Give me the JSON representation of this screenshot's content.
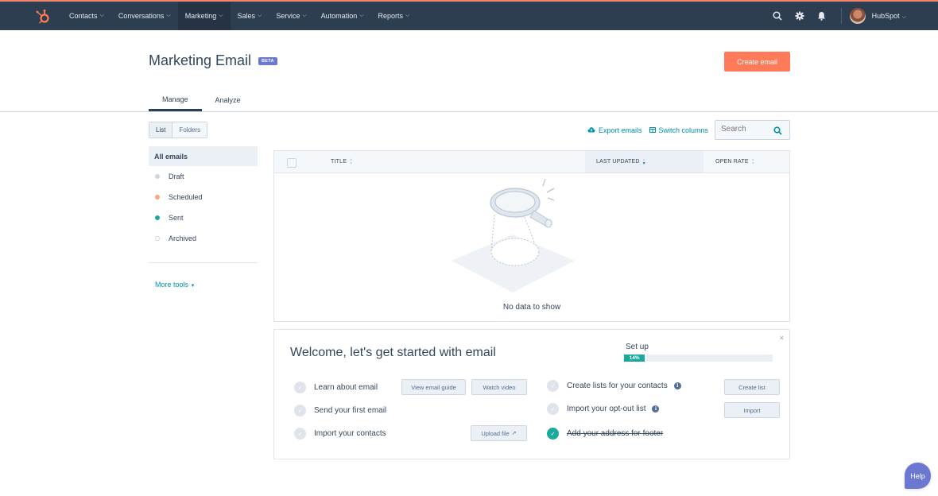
{
  "nav": {
    "items": [
      {
        "label": "Contacts",
        "active": false
      },
      {
        "label": "Conversations",
        "active": false
      },
      {
        "label": "Marketing",
        "active": true
      },
      {
        "label": "Sales",
        "active": false
      },
      {
        "label": "Service",
        "active": false
      },
      {
        "label": "Automation",
        "active": false
      },
      {
        "label": "Reports",
        "active": false
      }
    ],
    "account_name": "HubSpot",
    "icons": [
      "search-icon",
      "gear-icon",
      "bell-icon"
    ]
  },
  "header": {
    "title": "Marketing Email",
    "badge": "BETA",
    "create_label": "Create email"
  },
  "tabs": [
    {
      "label": "Manage",
      "active": true
    },
    {
      "label": "Analyze",
      "active": false
    }
  ],
  "view_toggle": {
    "list": "List",
    "folders": "Folders",
    "selected": "List"
  },
  "sidebar": {
    "items": [
      {
        "label": "All emails",
        "dot": null,
        "active": true
      },
      {
        "label": "Draft",
        "dot": "#cbd6e2",
        "active": false
      },
      {
        "label": "Scheduled",
        "dot": "#f5a77e",
        "active": false
      },
      {
        "label": "Sent",
        "dot": "#1aa99d",
        "active": false
      },
      {
        "label": "Archived",
        "dot": "hollow",
        "active": false
      }
    ],
    "more_tools": "More tools"
  },
  "toolbar": {
    "export_label": "Export emails",
    "switch_label": "Switch columns",
    "search_placeholder": "Search"
  },
  "table": {
    "columns": [
      "TITLE",
      "LAST UPDATED",
      "OPEN RATE"
    ],
    "sorted_column": "LAST UPDATED",
    "empty_text": "No data to show"
  },
  "welcome": {
    "title": "Welcome, let's get started with email",
    "setup_label": "Set up",
    "progress_percent": 14,
    "progress_text": "14%",
    "close": "×",
    "left_tasks": [
      {
        "label": "Learn about email",
        "done": false,
        "buttons": [
          "View email guide",
          "Watch video"
        ]
      },
      {
        "label": "Send your first email",
        "done": false,
        "buttons": []
      },
      {
        "label": "Import your contacts",
        "done": false,
        "buttons": [
          "Upload file"
        ]
      }
    ],
    "right_tasks": [
      {
        "label": "Create lists for your contacts",
        "done": false,
        "info": true,
        "buttons": [
          "Create list"
        ]
      },
      {
        "label": "Import your opt-out list",
        "done": false,
        "info": true,
        "buttons": [
          "Import"
        ]
      },
      {
        "label": "Add your address for footer",
        "done": true,
        "info": false,
        "buttons": []
      }
    ]
  },
  "help_label": "Help",
  "colors": {
    "nav_bg": "#2d3e50",
    "accent": "#ff7a59",
    "link": "#0091ae",
    "success": "#1aa99d",
    "beta": "#6a78d1"
  }
}
